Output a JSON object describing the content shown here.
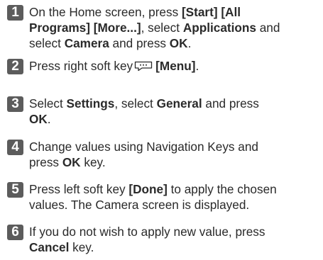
{
  "steps": [
    {
      "number": "1",
      "lines": [
        [
          {
            "t": "On the Home screen, press "
          },
          {
            "t": "[Start] [All",
            "b": true
          }
        ],
        [
          {
            "t": "Programs] [More...]",
            "b": true
          },
          {
            "t": ", select "
          },
          {
            "t": "Applications",
            "b": true
          },
          {
            "t": " and"
          }
        ],
        [
          {
            "t": "select "
          },
          {
            "t": "Camera",
            "b": true
          },
          {
            "t": " and press "
          },
          {
            "t": "OK",
            "b": true
          },
          {
            "t": "."
          }
        ]
      ]
    },
    {
      "number": "2",
      "lines": [
        [
          {
            "t": "Press right soft key"
          },
          {
            "icon": "menu-soft-key-icon"
          },
          {
            "t": "[Menu]",
            "b": true
          },
          {
            "t": "."
          }
        ]
      ]
    },
    {
      "number": "3",
      "lines": [
        [
          {
            "t": "Select "
          },
          {
            "t": "Settings",
            "b": true
          },
          {
            "t": ", select "
          },
          {
            "t": "General",
            "b": true
          },
          {
            "t": " and press"
          }
        ],
        [
          {
            "t": "OK",
            "b": true
          },
          {
            "t": "."
          }
        ]
      ]
    },
    {
      "number": "4",
      "lines": [
        [
          {
            "t": "Change values using Navigation Keys and"
          }
        ],
        [
          {
            "t": "press "
          },
          {
            "t": "OK",
            "b": true
          },
          {
            "t": " key."
          }
        ]
      ]
    },
    {
      "number": "5",
      "lines": [
        [
          {
            "t": "Press left soft key "
          },
          {
            "t": "[Done]",
            "b": true
          },
          {
            "t": " to apply the chosen"
          }
        ],
        [
          {
            "t": "values. The Camera screen is displayed."
          }
        ]
      ]
    },
    {
      "number": "6",
      "lines": [
        [
          {
            "t": "If you do not wish to apply new value, press"
          }
        ],
        [
          {
            "t": "Cancel",
            "b": true
          },
          {
            "t": " key."
          }
        ]
      ]
    }
  ],
  "colors": {
    "badge": "#5c5c5c",
    "text": "#2a2a2a"
  }
}
